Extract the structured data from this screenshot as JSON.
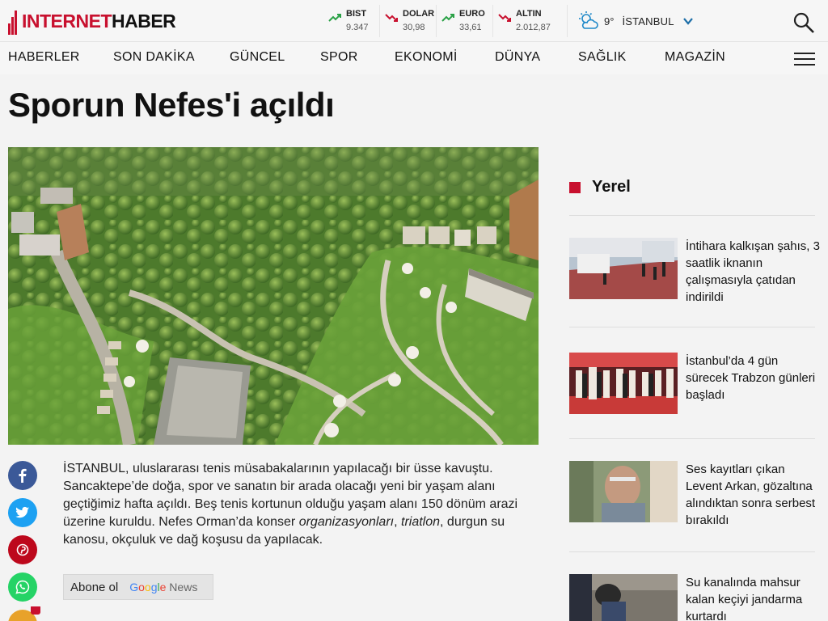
{
  "header": {
    "logo_a": "INTERNET",
    "logo_b": "HABER",
    "tickers": [
      {
        "name": "BIST",
        "value": "9.347",
        "direction": "up"
      },
      {
        "name": "DOLAR",
        "value": "30,98",
        "direction": "down"
      },
      {
        "name": "EURO",
        "value": "33,61",
        "direction": "up"
      },
      {
        "name": "ALTIN",
        "value": "2.012,87",
        "direction": "down"
      }
    ],
    "weather": {
      "temp": "9°",
      "city": "İSTANBUL",
      "icon": "partly-sunny-icon"
    },
    "search_icon": "search-icon"
  },
  "nav": {
    "items": [
      "HABERLER",
      "SON DAKİKA",
      "GÜNCEL",
      "SPOR",
      "EKONOMİ",
      "DÜNYA",
      "SAĞLIK",
      "MAGAZİN"
    ],
    "menu_icon": "hamburger-icon"
  },
  "article": {
    "title": "Sporun Nefes'i açıldı",
    "body_1": "İSTANBUL, uluslararası tenis müsabakalarının yapılacağı bir üsse kavuştu. Sancaktepe’de doğa, spor ve sanatın bir arada olacağı yeni bir yaşam alanı geçtiğimiz hafta açıldı. Beş tenis kortunun olduğu yaşam alanı 150 dönüm arazi üzerine kuruldu. Nefes Orman’da konser ",
    "body_em1": "organizasyonları",
    "body_2": ", ",
    "body_em2": "triatlon",
    "body_3": ", durgun su kanosu, okçuluk ve dağ koşusu da yapılacak.",
    "subscribe_label": "Abone ol",
    "google_news": {
      "g": "G",
      "o1": "o",
      "o2": "o",
      "g2": "g",
      "l": "l",
      "e": "e",
      "news": " News"
    }
  },
  "share": [
    {
      "name": "facebook",
      "glyph": "f",
      "color": "#3b5998"
    },
    {
      "name": "twitter",
      "glyph": "t",
      "color": "#1da1f2"
    },
    {
      "name": "pinterest",
      "glyph": "p",
      "color": "#bd081c"
    },
    {
      "name": "whatsapp",
      "glyph": "w",
      "color": "#25d366"
    }
  ],
  "sidebar": {
    "heading": "Yerel",
    "items": [
      {
        "title": "İntihara kalkışan şahıs, 3 saatlik iknanın çalışmasıyla çatıdan indirildi"
      },
      {
        "title": "İstanbul’da 4 gün sürecek Trabzon günleri başladı"
      },
      {
        "title": "Ses kayıtları çıkan Levent Arkan, gözaltına alındıktan sonra serbest bırakıldı"
      },
      {
        "title": "Su kanalında mahsur kalan keçiyi jandarma kurtardı"
      }
    ]
  },
  "colors": {
    "brand": "#c8102e",
    "up": "#2aa146",
    "down": "#c8102e"
  }
}
